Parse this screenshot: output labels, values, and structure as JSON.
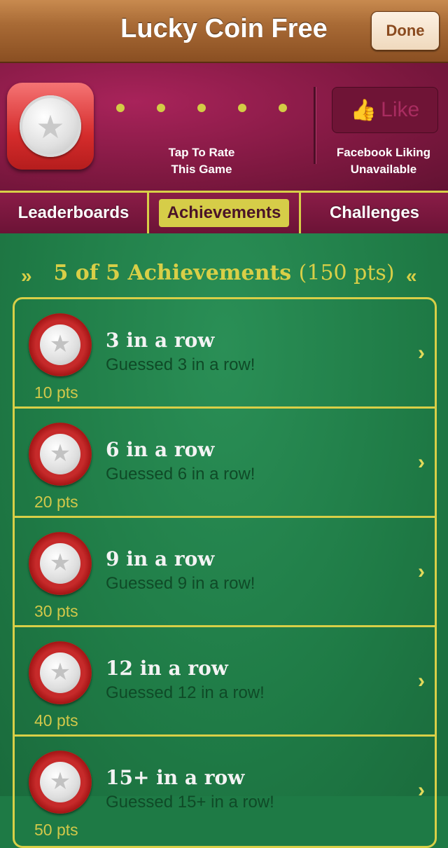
{
  "navbar": {
    "title": "Lucky Coin Free",
    "done_label": "Done"
  },
  "header": {
    "rate_label_line1": "Tap To Rate",
    "rate_label_line2": "This Game",
    "like_label": "Like",
    "fb_line1": "Facebook Liking",
    "fb_line2": "Unavailable"
  },
  "tabs": [
    {
      "label": "Leaderboards"
    },
    {
      "label": "Achievements",
      "selected": true
    },
    {
      "label": "Challenges"
    }
  ],
  "summary": {
    "count_text": "5 of 5 Achievements",
    "points_text": "(150 pts)"
  },
  "achievements": [
    {
      "name": "3 in a row",
      "desc": "Guessed 3 in a row!",
      "pts": "10 pts"
    },
    {
      "name": "6 in a row",
      "desc": "Guessed 6 in a row!",
      "pts": "20 pts"
    },
    {
      "name": "9 in a row",
      "desc": "Guessed 9 in a row!",
      "pts": "30 pts"
    },
    {
      "name": "12 in a row",
      "desc": "Guessed 12 in a row!",
      "pts": "40 pts"
    },
    {
      "name": "15+ in a row",
      "desc": "Guessed 15+ in a row!",
      "pts": "50 pts"
    }
  ],
  "icons": {
    "coin": "coin-star-icon",
    "thumb": "thumbs-up-icon",
    "chevron": "chevron-right-icon"
  },
  "colors": {
    "felt_green": "#1f7b46",
    "felt_crimson": "#7e1840",
    "gold": "#d8cf47",
    "wood": "#a86a35"
  }
}
